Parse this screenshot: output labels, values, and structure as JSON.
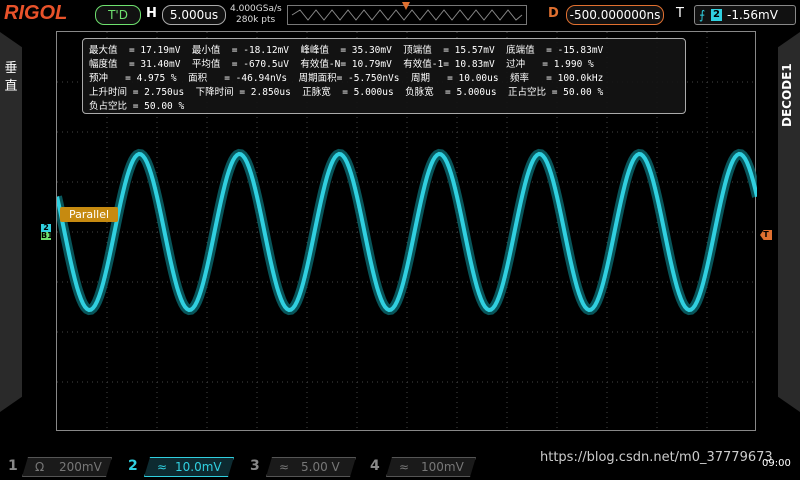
{
  "topbar": {
    "logo": "RIGOL",
    "run_state": "T'D",
    "timebase_label": "H",
    "timebase": "5.000us",
    "sample_rate": "4.000GSa/s",
    "memory_depth": "280k pts",
    "delay_label": "D",
    "delay": "-500.000000ns",
    "trigger_label": "T",
    "trigger_channel": "2",
    "trigger_level": "-1.56mV"
  },
  "side": {
    "left_label": "垂直",
    "right_label": "DECODE1"
  },
  "measurements": {
    "rows": [
      "最大值  = 17.19mV  最小值  = -18.12mV  峰峰值  = 35.30mV  顶端值  = 15.57mV  底端值  = -15.83mV",
      "幅度值  = 31.40mV  平均值  = -670.5uV  有效值-N= 10.79mV  有效值-1= 10.83mV  过冲   = 1.990 %",
      "预冲   = 4.975 %  面积   = -46.94nVs  周期面积= -5.750nVs  周期   = 10.00us  频率   = 100.0kHz",
      "上升时间 = 2.750us  下降时间 = 2.850us  正脉宽  = 5.000us  负脉宽  = 5.000us  正占空比 = 50.00 %",
      "负占空比 = 50.00 %"
    ]
  },
  "overlay": {
    "decode_label": "Parallel",
    "ch_marker_2": "2",
    "ch_marker_b1": "B1",
    "trigger_marker": "T"
  },
  "channels": [
    {
      "num": "1",
      "coupling": "Ω",
      "scale": "200mV",
      "active": false
    },
    {
      "num": "2",
      "coupling": "≈",
      "scale": "10.0mV",
      "active": true
    },
    {
      "num": "3",
      "coupling": "≈",
      "scale": "5.00 V",
      "active": false
    },
    {
      "num": "4",
      "coupling": "≈",
      "scale": "100mV",
      "active": false
    }
  ],
  "watermark": "https://blog.csdn.net/m0_37779673",
  "clock": "09:00",
  "colors": {
    "ch2": "#30d0e0",
    "trigger": "#e07030",
    "logo": "#e8522a",
    "decode": "#c68a10"
  },
  "waveform": {
    "periods_visible": 7,
    "amplitude_mV": 15.7,
    "frequency_kHz": 100.0
  }
}
